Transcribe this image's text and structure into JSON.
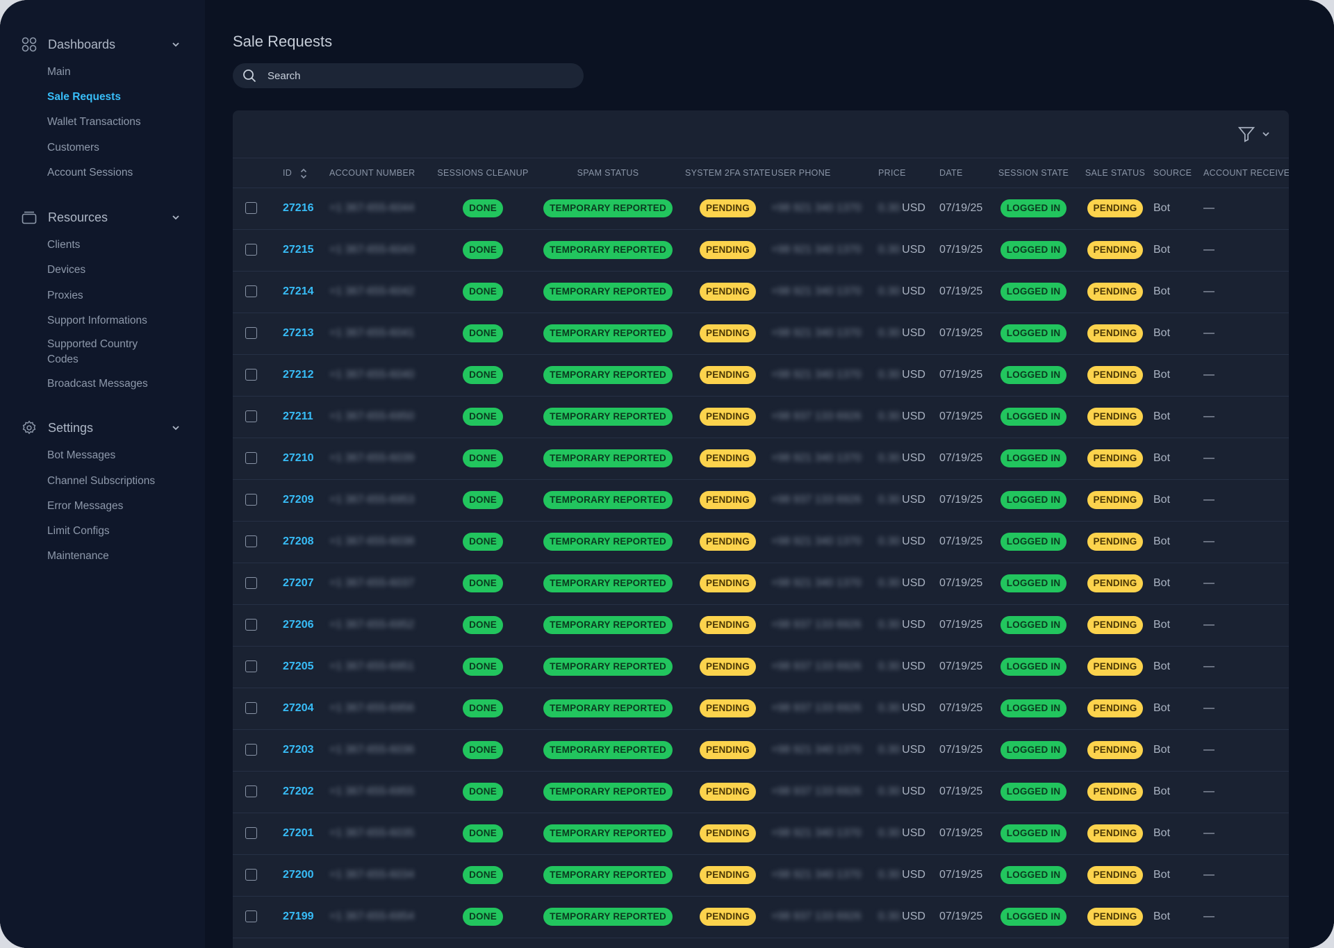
{
  "sidebar": {
    "groups": [
      {
        "label": "Dashboards",
        "icon": "grid-icon",
        "items": [
          "Main",
          "Sale Requests",
          "Wallet Transactions",
          "Customers",
          "Account Sessions"
        ]
      },
      {
        "label": "Resources",
        "icon": "database-icon",
        "items": [
          "Clients",
          "Devices",
          "Proxies",
          "Support Informations",
          "Supported Country Codes",
          "Broadcast Messages"
        ]
      },
      {
        "label": "Settings",
        "icon": "gear-icon",
        "items": [
          "Bot Messages",
          "Channel Subscriptions",
          "Error Messages",
          "Limit Configs",
          "Maintenance"
        ]
      }
    ],
    "active_item": "Sale Requests"
  },
  "page": {
    "title": "Sale Requests",
    "search_placeholder": "Search"
  },
  "table": {
    "columns": [
      "ID",
      "ACCOUNT NUMBER",
      "SESSIONS CLEANUP",
      "SPAM STATUS",
      "SYSTEM 2FA STATE",
      "USER PHONE",
      "PRICE",
      "DATE",
      "SESSION STATE",
      "SALE STATUS",
      "SOURCE",
      "ACCOUNT RECEIVE"
    ],
    "rows": [
      {
        "id": "27216",
        "account": "+1 367-655-6044",
        "cleanup": "DONE",
        "spam": "TEMPORARY REPORTED",
        "twofa": "PENDING",
        "phone": "+98 921 340 1370",
        "price_amount": "0.30",
        "currency": "USD",
        "date": "07/19/25",
        "session": "LOGGED IN",
        "sale": "PENDING",
        "source": "Bot",
        "receive": "—"
      },
      {
        "id": "27215",
        "account": "+1 367-655-6043",
        "cleanup": "DONE",
        "spam": "TEMPORARY REPORTED",
        "twofa": "PENDING",
        "phone": "+98 921 340 1370",
        "price_amount": "0.30",
        "currency": "USD",
        "date": "07/19/25",
        "session": "LOGGED IN",
        "sale": "PENDING",
        "source": "Bot",
        "receive": "—"
      },
      {
        "id": "27214",
        "account": "+1 367-655-6042",
        "cleanup": "DONE",
        "spam": "TEMPORARY REPORTED",
        "twofa": "PENDING",
        "phone": "+98 921 340 1370",
        "price_amount": "0.30",
        "currency": "USD",
        "date": "07/19/25",
        "session": "LOGGED IN",
        "sale": "PENDING",
        "source": "Bot",
        "receive": "—"
      },
      {
        "id": "27213",
        "account": "+1 367-655-6041",
        "cleanup": "DONE",
        "spam": "TEMPORARY REPORTED",
        "twofa": "PENDING",
        "phone": "+98 921 340 1370",
        "price_amount": "0.30",
        "currency": "USD",
        "date": "07/19/25",
        "session": "LOGGED IN",
        "sale": "PENDING",
        "source": "Bot",
        "receive": "—"
      },
      {
        "id": "27212",
        "account": "+1 367-655-6040",
        "cleanup": "DONE",
        "spam": "TEMPORARY REPORTED",
        "twofa": "PENDING",
        "phone": "+98 921 340 1370",
        "price_amount": "0.30",
        "currency": "USD",
        "date": "07/19/25",
        "session": "LOGGED IN",
        "sale": "PENDING",
        "source": "Bot",
        "receive": "—"
      },
      {
        "id": "27211",
        "account": "+1 367-655-6950",
        "cleanup": "DONE",
        "spam": "TEMPORARY REPORTED",
        "twofa": "PENDING",
        "phone": "+98 937 133 6926",
        "price_amount": "0.30",
        "currency": "USD",
        "date": "07/19/25",
        "session": "LOGGED IN",
        "sale": "PENDING",
        "source": "Bot",
        "receive": "—"
      },
      {
        "id": "27210",
        "account": "+1 367-655-6039",
        "cleanup": "DONE",
        "spam": "TEMPORARY REPORTED",
        "twofa": "PENDING",
        "phone": "+98 921 340 1370",
        "price_amount": "0.30",
        "currency": "USD",
        "date": "07/19/25",
        "session": "LOGGED IN",
        "sale": "PENDING",
        "source": "Bot",
        "receive": "—"
      },
      {
        "id": "27209",
        "account": "+1 367-655-6953",
        "cleanup": "DONE",
        "spam": "TEMPORARY REPORTED",
        "twofa": "PENDING",
        "phone": "+98 937 133 6926",
        "price_amount": "0.30",
        "currency": "USD",
        "date": "07/19/25",
        "session": "LOGGED IN",
        "sale": "PENDING",
        "source": "Bot",
        "receive": "—"
      },
      {
        "id": "27208",
        "account": "+1 367-655-6038",
        "cleanup": "DONE",
        "spam": "TEMPORARY REPORTED",
        "twofa": "PENDING",
        "phone": "+98 921 340 1370",
        "price_amount": "0.30",
        "currency": "USD",
        "date": "07/19/25",
        "session": "LOGGED IN",
        "sale": "PENDING",
        "source": "Bot",
        "receive": "—"
      },
      {
        "id": "27207",
        "account": "+1 367-655-6037",
        "cleanup": "DONE",
        "spam": "TEMPORARY REPORTED",
        "twofa": "PENDING",
        "phone": "+98 921 340 1370",
        "price_amount": "0.30",
        "currency": "USD",
        "date": "07/19/25",
        "session": "LOGGED IN",
        "sale": "PENDING",
        "source": "Bot",
        "receive": "—"
      },
      {
        "id": "27206",
        "account": "+1 367-655-6952",
        "cleanup": "DONE",
        "spam": "TEMPORARY REPORTED",
        "twofa": "PENDING",
        "phone": "+98 937 133 6926",
        "price_amount": "0.30",
        "currency": "USD",
        "date": "07/19/25",
        "session": "LOGGED IN",
        "sale": "PENDING",
        "source": "Bot",
        "receive": "—"
      },
      {
        "id": "27205",
        "account": "+1 367-655-6951",
        "cleanup": "DONE",
        "spam": "TEMPORARY REPORTED",
        "twofa": "PENDING",
        "phone": "+98 937 133 6926",
        "price_amount": "0.30",
        "currency": "USD",
        "date": "07/19/25",
        "session": "LOGGED IN",
        "sale": "PENDING",
        "source": "Bot",
        "receive": "—"
      },
      {
        "id": "27204",
        "account": "+1 367-655-6956",
        "cleanup": "DONE",
        "spam": "TEMPORARY REPORTED",
        "twofa": "PENDING",
        "phone": "+98 937 133 6926",
        "price_amount": "0.30",
        "currency": "USD",
        "date": "07/19/25",
        "session": "LOGGED IN",
        "sale": "PENDING",
        "source": "Bot",
        "receive": "—"
      },
      {
        "id": "27203",
        "account": "+1 367-655-6036",
        "cleanup": "DONE",
        "spam": "TEMPORARY REPORTED",
        "twofa": "PENDING",
        "phone": "+98 921 340 1370",
        "price_amount": "0.30",
        "currency": "USD",
        "date": "07/19/25",
        "session": "LOGGED IN",
        "sale": "PENDING",
        "source": "Bot",
        "receive": "—"
      },
      {
        "id": "27202",
        "account": "+1 367-655-6955",
        "cleanup": "DONE",
        "spam": "TEMPORARY REPORTED",
        "twofa": "PENDING",
        "phone": "+98 937 133 6926",
        "price_amount": "0.30",
        "currency": "USD",
        "date": "07/19/25",
        "session": "LOGGED IN",
        "sale": "PENDING",
        "source": "Bot",
        "receive": "—"
      },
      {
        "id": "27201",
        "account": "+1 367-655-6035",
        "cleanup": "DONE",
        "spam": "TEMPORARY REPORTED",
        "twofa": "PENDING",
        "phone": "+98 921 340 1370",
        "price_amount": "0.30",
        "currency": "USD",
        "date": "07/19/25",
        "session": "LOGGED IN",
        "sale": "PENDING",
        "source": "Bot",
        "receive": "—"
      },
      {
        "id": "27200",
        "account": "+1 367-655-6034",
        "cleanup": "DONE",
        "spam": "TEMPORARY REPORTED",
        "twofa": "PENDING",
        "phone": "+98 921 340 1370",
        "price_amount": "0.30",
        "currency": "USD",
        "date": "07/19/25",
        "session": "LOGGED IN",
        "sale": "PENDING",
        "source": "Bot",
        "receive": "—"
      },
      {
        "id": "27199",
        "account": "+1 367-655-6954",
        "cleanup": "DONE",
        "spam": "TEMPORARY REPORTED",
        "twofa": "PENDING",
        "phone": "+98 937 133 6926",
        "price_amount": "0.30",
        "currency": "USD",
        "date": "07/19/25",
        "session": "LOGGED IN",
        "sale": "PENDING",
        "source": "Bot",
        "receive": "—"
      }
    ]
  },
  "colors": {
    "accent": "#38bdf8",
    "badge_green": "#22c55e",
    "badge_yellow": "#fcd34d",
    "background": "#0b1222",
    "sidebar": "#0f172a",
    "card": "#1a2232"
  }
}
